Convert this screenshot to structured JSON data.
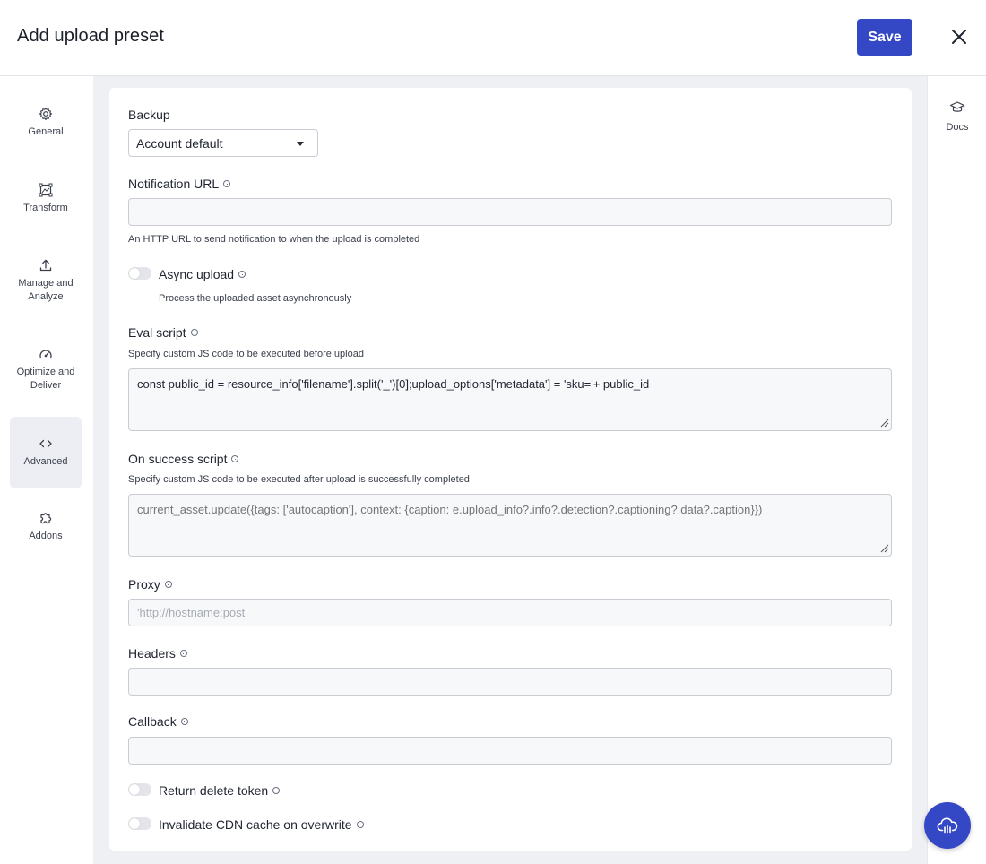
{
  "header": {
    "title": "Add upload preset",
    "save_label": "Save"
  },
  "leftnav": {
    "items": [
      {
        "label": "General",
        "icon": "gear-icon"
      },
      {
        "label": "Transform",
        "icon": "transform-icon"
      },
      {
        "label": "Manage and\nAnalyze",
        "icon": "upload-icon"
      },
      {
        "label": "Optimize and\nDeliver",
        "icon": "gauge-icon"
      },
      {
        "label": "Advanced",
        "icon": "code-icon",
        "active": true
      },
      {
        "label": "Addons",
        "icon": "puzzle-icon"
      }
    ]
  },
  "rightrail": {
    "docs_label": "Docs"
  },
  "form": {
    "backup": {
      "label": "Backup",
      "value": "Account default"
    },
    "notification_url": {
      "label": "Notification URL",
      "value": "",
      "help": "An HTTP URL to send notification to when the upload is completed"
    },
    "async_upload": {
      "label": "Async upload",
      "help": "Process the uploaded asset asynchronously",
      "enabled": false
    },
    "eval_script": {
      "label": "Eval script",
      "help": "Specify custom JS code to be executed before upload",
      "value": "const public_id = resource_info['filename'].split('_')[0];upload_options['metadata'] = 'sku='+ public_id"
    },
    "on_success_script": {
      "label": "On success script",
      "help": "Specify custom JS code to be executed after upload is successfully completed",
      "placeholder": "current_asset.update({tags: ['autocaption'], context: {caption: e.upload_info?.info?.detection?.captioning?.data?.caption}})"
    },
    "proxy": {
      "label": "Proxy",
      "placeholder": "'http://hostname:post'"
    },
    "headers": {
      "label": "Headers",
      "value": ""
    },
    "callback": {
      "label": "Callback",
      "value": ""
    },
    "return_delete_token": {
      "label": "Return delete token",
      "enabled": false
    },
    "invalidate_cdn": {
      "label": "Invalidate CDN cache on overwrite",
      "enabled": false
    }
  },
  "colors": {
    "primary": "#3448c5",
    "background": "#eef0f4"
  }
}
